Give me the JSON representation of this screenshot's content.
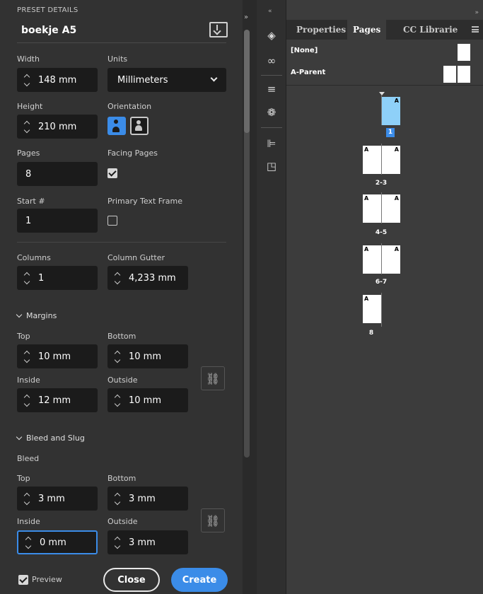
{
  "preset": {
    "header": "PRESET DETAILS",
    "doc_name": "boekje A5",
    "width": {
      "label": "Width",
      "value": "148 mm"
    },
    "units": {
      "label": "Units",
      "value": "Millimeters"
    },
    "height": {
      "label": "Height",
      "value": "210 mm"
    },
    "orientation": {
      "label": "Orientation",
      "selected": "portrait"
    },
    "pages": {
      "label": "Pages",
      "value": "8"
    },
    "facing_pages": {
      "label": "Facing Pages",
      "checked": true
    },
    "start": {
      "label": "Start #",
      "value": "1"
    },
    "primary_text_frame": {
      "label": "Primary Text Frame",
      "checked": false
    },
    "columns": {
      "label": "Columns",
      "value": "1"
    },
    "column_gutter": {
      "label": "Column Gutter",
      "value": "4,233 mm"
    },
    "margins": {
      "section": "Margins",
      "top": {
        "label": "Top",
        "value": "10 mm"
      },
      "bottom": {
        "label": "Bottom",
        "value": "10 mm"
      },
      "inside": {
        "label": "Inside",
        "value": "12 mm"
      },
      "outside": {
        "label": "Outside",
        "value": "10 mm"
      }
    },
    "bleed_slug": {
      "section": "Bleed and Slug",
      "bleed_label": "Bleed",
      "top": {
        "label": "Top",
        "value": "3 mm"
      },
      "bottom": {
        "label": "Bottom",
        "value": "3 mm"
      },
      "inside": {
        "label": "Inside",
        "value": "0 mm"
      },
      "outside": {
        "label": "Outside",
        "value": "3 mm"
      }
    },
    "footer": {
      "preview_label": "Preview",
      "preview_checked": true,
      "close_label": "Close",
      "create_label": "Create"
    }
  },
  "toolbar": {
    "icons": [
      "layers-icon",
      "links-icon",
      "stroke-icon",
      "swatches-icon",
      "align-icon",
      "pathfinder-icon"
    ]
  },
  "pages_panel": {
    "tabs": [
      "Properties",
      "Pages",
      "CC Librarie"
    ],
    "active_tab": "Pages",
    "masters": [
      {
        "label": "[None]"
      },
      {
        "label": "A-Parent"
      }
    ],
    "page_master_letter": "A",
    "spreads": [
      {
        "label": "1"
      },
      {
        "label": "2-3"
      },
      {
        "label": "4-5"
      },
      {
        "label": "6-7"
      },
      {
        "label": "8"
      }
    ]
  },
  "colors": {
    "accent": "#3b8ce8",
    "panel_bg": "#323232",
    "field_bg": "#1b1b1b",
    "pages_bg": "#3c3c3c",
    "selected_page": "#8ed0f8"
  }
}
